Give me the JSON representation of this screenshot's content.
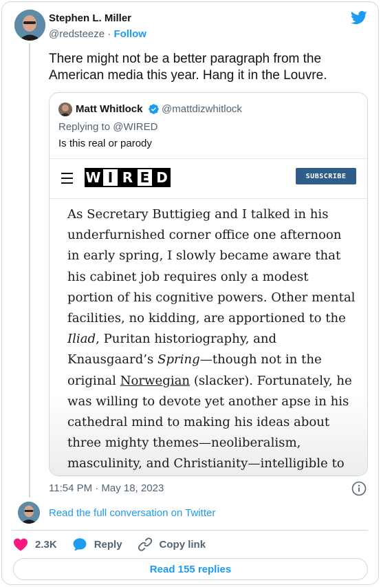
{
  "author": {
    "name": "Stephen L. Miller",
    "handle": "@redsteeze",
    "separator": "·",
    "follow_label": "Follow"
  },
  "tweet": {
    "text": "There might not be a better paragraph from the American media this year. Hang it in the Louvre."
  },
  "quoted_tweet": {
    "name": "Matt Whitlock",
    "handle": "@mattdizwhitlock",
    "replying_to": "Replying to @WIRED",
    "text": "Is this real or parody",
    "wired_logo_letters": [
      "W",
      "I",
      "R",
      "E",
      "D"
    ],
    "subscribe_label": "SUBSCRIBE",
    "article": {
      "part1": "As Secretary Buttigieg and I talked in his underfurnished corner office one afternoon in early spring, I slowly became aware that his cabinet job requires only a modest portion of his cognitive powers. Other mental facilities, no kidding, are apportioned to the ",
      "italic1": "Iliad",
      "part2": ", Puritan historiography, and Knausgaard’s ",
      "italic2": "Spring",
      "part3": "—though not in the original ",
      "underlined": "Norwegian",
      "part4": " (slacker). Fortunately, he was willing to devote yet another apse in his cathedral mind to making his ideas about three mighty themes—neoliberalism, masculinity, and Christianity—intelligible to me."
    }
  },
  "timestamp": "11:54 PM · May 18, 2023",
  "read_conversation": "Read the full conversation on Twitter",
  "actions": {
    "likes": "2.3K",
    "reply_label": "Reply",
    "copy_link_label": "Copy link"
  },
  "read_replies_label": "Read 155 replies",
  "colors": {
    "accent": "#1d9bf0",
    "like": "#f91880",
    "subscribe": "#2f5d8a"
  },
  "icons": [
    "twitter-bird-icon",
    "verified-badge-icon",
    "hamburger-icon",
    "info-icon",
    "heart-icon",
    "reply-bubble-icon",
    "link-icon"
  ]
}
